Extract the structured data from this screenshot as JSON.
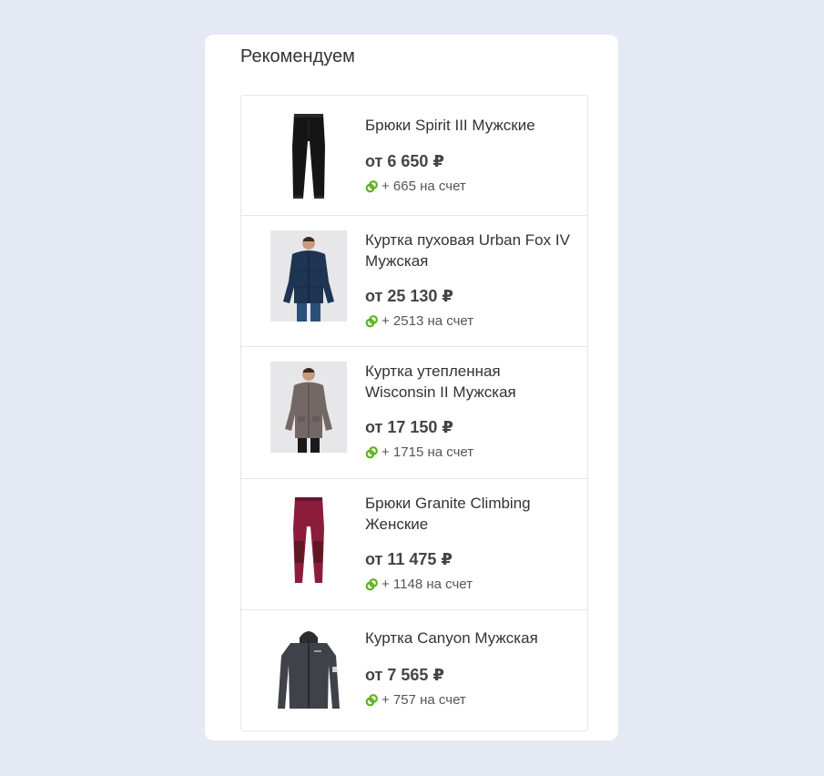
{
  "section_title": "Рекомендуем",
  "bonus_suffix": "на счет",
  "colors": {
    "page_background": "#e5e9f3",
    "card_background": "#ffffff",
    "bonus_icon": "#5fb31f",
    "text": "#333333"
  },
  "products": [
    {
      "name": "Брюки Spirit III Мужские",
      "price": "от 6 650 ₽",
      "bonus": "+ 665",
      "image": "black-trousers"
    },
    {
      "name": "Куртка пуховая Urban Fox IV Мужская",
      "price": "от 25 130 ₽",
      "bonus": "+ 2513",
      "image": "man-in-navy-down-jacket"
    },
    {
      "name": "Куртка утепленная Wisconsin II Мужская",
      "price": "от 17 150 ₽",
      "bonus": "+ 1715",
      "image": "man-in-grey-insulated-jacket"
    },
    {
      "name": "Брюки Granite Climbing Женские",
      "price": "от 11 475 ₽",
      "bonus": "+ 1148",
      "image": "burgundy-climbing-trousers"
    },
    {
      "name": "Куртка Canyon Мужская",
      "price": "от 7 565 ₽",
      "bonus": "+ 757",
      "image": "dark-grey-softshell-jacket"
    }
  ]
}
